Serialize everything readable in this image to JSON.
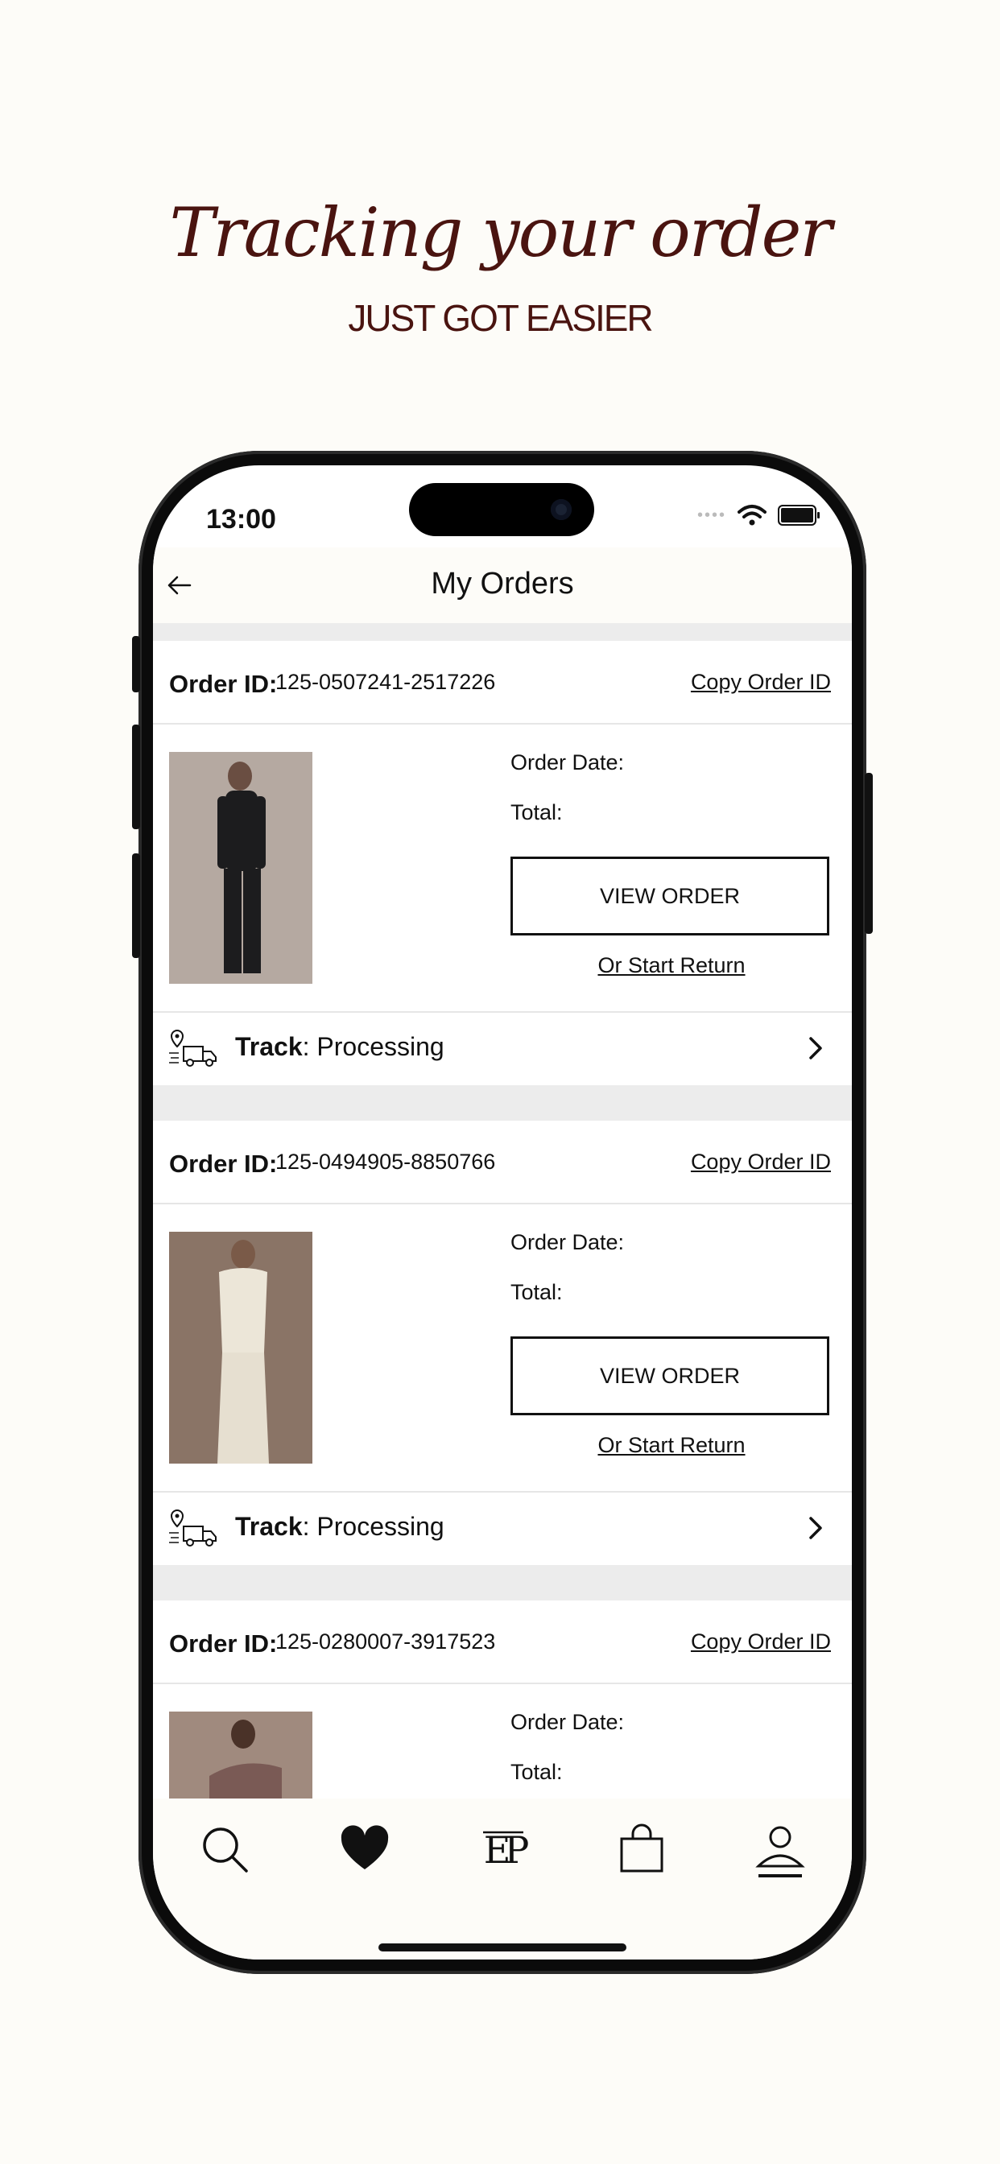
{
  "promo": {
    "title": "Tracking your order",
    "subtitle": "JUST GOT EASIER"
  },
  "status_bar": {
    "time": "13:00",
    "dots": "••••"
  },
  "header": {
    "title": "My Orders",
    "back_icon": "arrow-left-icon"
  },
  "orders": [
    {
      "id_label": "Order ID:",
      "id": "125-0507241-2517226",
      "copy_label": "Copy Order ID",
      "date_label": "Order Date:",
      "total_label": "Total:",
      "view_label": "VIEW ORDER",
      "return_label": "Or Start Return",
      "track_label": "Track",
      "track_status": ": Processing",
      "outfit_color": "#1c1c1e"
    },
    {
      "id_label": "Order ID:",
      "id": "125-0494905-8850766",
      "copy_label": "Copy Order ID",
      "date_label": "Order Date:",
      "total_label": "Total:",
      "view_label": "VIEW ORDER",
      "return_label": "Or Start Return",
      "track_label": "Track",
      "track_status": ": Processing",
      "outfit_color": "#ece6d8"
    },
    {
      "id_label": "Order ID:",
      "id": "125-0280007-3917523",
      "copy_label": "Copy Order ID",
      "date_label": "Order Date:",
      "total_label": "Total:",
      "outfit_color": "#7a5a55"
    }
  ],
  "tabbar": {
    "items": [
      "search-icon",
      "heart-icon",
      "brand-logo-icon",
      "shopping-bag-icon",
      "account-icon"
    ],
    "active": "account-icon"
  },
  "colors": {
    "brand": "#4a1410",
    "background": "#fdfcf8",
    "separator": "#ececec"
  }
}
